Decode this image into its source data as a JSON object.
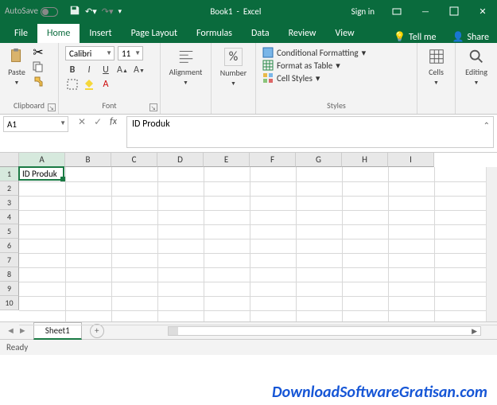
{
  "titlebar": {
    "autosave": "AutoSave",
    "doc": "Book1",
    "app": "Excel",
    "signin": "Sign in"
  },
  "tabs": {
    "file": "File",
    "home": "Home",
    "insert": "Insert",
    "pagelayout": "Page Layout",
    "formulas": "Formulas",
    "data": "Data",
    "review": "Review",
    "view": "View",
    "tellme": "Tell me",
    "share": "Share"
  },
  "ribbon": {
    "clipboard": {
      "paste": "Paste",
      "label": "Clipboard"
    },
    "font": {
      "name": "Calibri",
      "size": "11",
      "bold": "B",
      "italic": "I",
      "underline": "U",
      "label": "Font"
    },
    "alignment": {
      "label": "Alignment"
    },
    "number": {
      "label": "Number",
      "percent": "%"
    },
    "styles": {
      "cond": "Conditional Formatting",
      "fat": "Format as Table",
      "cell": "Cell Styles",
      "label": "Styles"
    },
    "cells": {
      "label": "Cells"
    },
    "editing": {
      "label": "Editing"
    }
  },
  "namebox": "A1",
  "formula_bar": "ID Produk",
  "columns": [
    "A",
    "B",
    "C",
    "D",
    "E",
    "F",
    "G",
    "H",
    "I"
  ],
  "rows": [
    "1",
    "2",
    "3",
    "4",
    "5",
    "6",
    "7",
    "8",
    "9",
    "10"
  ],
  "active_cell_value": "ID Produk",
  "sheet": "Sheet1",
  "status": "Ready",
  "watermark": "DownloadSoftwareGratisan.com"
}
